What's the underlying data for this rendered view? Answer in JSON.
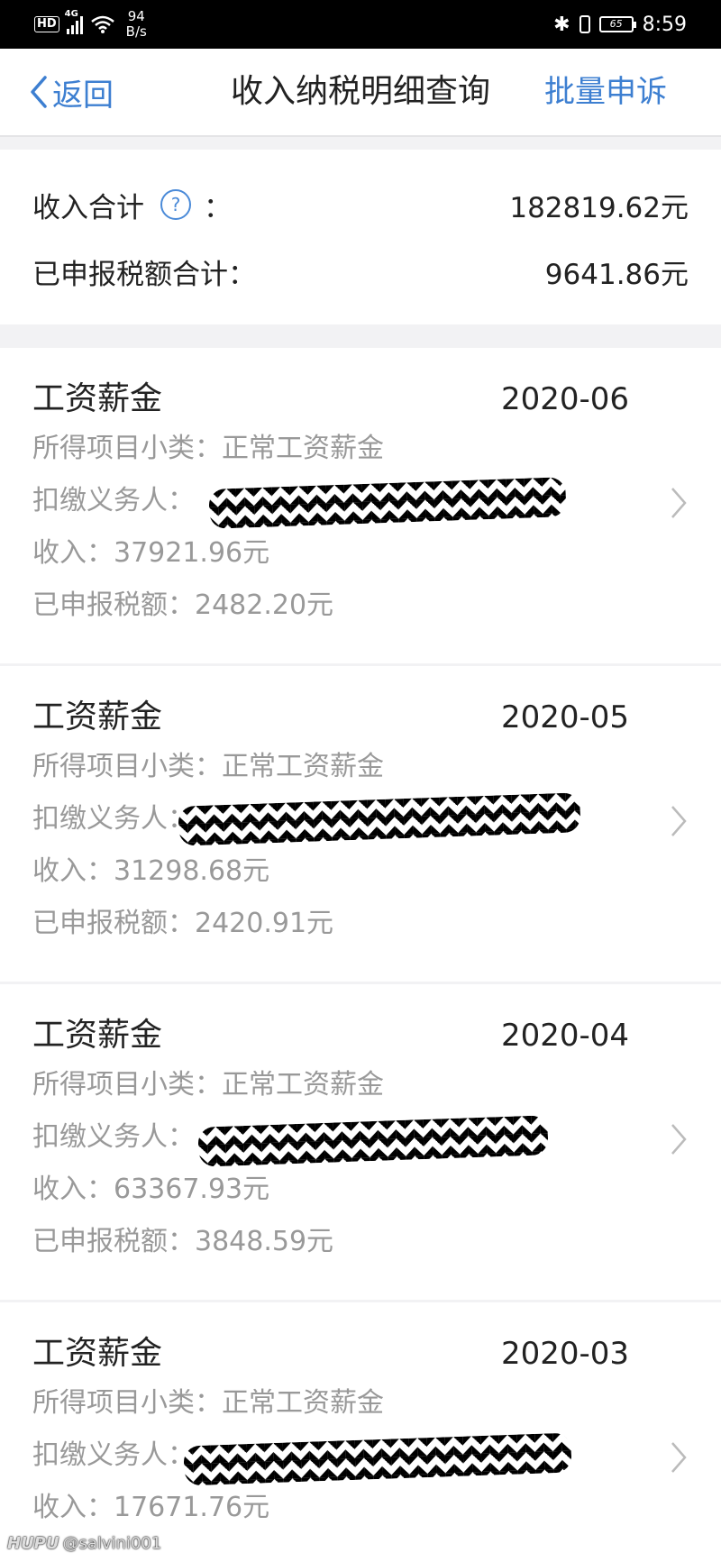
{
  "status_bar": {
    "network_badge": "HD",
    "network_type": "4G",
    "speed_value": "94",
    "speed_unit": "B/s",
    "battery": "65",
    "time": "8:59"
  },
  "nav": {
    "back_label": "返回",
    "title": "收入纳税明细查询",
    "action_label": "批量申诉"
  },
  "summary": {
    "income_label": "收入合计",
    "help_glyph": "?",
    "colon": "：",
    "income_value": "182819.62元",
    "tax_label": "已申报税额合计：",
    "tax_value": "9641.86元"
  },
  "records": [
    {
      "category": "工资薪金",
      "period": "2020-06",
      "subcategory": "所得项目小类：正常工资薪金",
      "withholder_label": "扣缴义务人：",
      "income": "收入：37921.96元",
      "tax": "已申报税额：2482.20元"
    },
    {
      "category": "工资薪金",
      "period": "2020-05",
      "subcategory": "所得项目小类：正常工资薪金",
      "withholder_label": "扣缴义务人：",
      "income": "收入：31298.68元",
      "tax": "已申报税额：2420.91元"
    },
    {
      "category": "工资薪金",
      "period": "2020-04",
      "subcategory": "所得项目小类：正常工资薪金",
      "withholder_label": "扣缴义务人：",
      "income": "收入：63367.93元",
      "tax": "已申报税额：3848.59元"
    },
    {
      "category": "工资薪金",
      "period": "2020-03",
      "subcategory": "所得项目小类：正常工资薪金",
      "withholder_label": "扣缴义务人：",
      "income": "收入：17671.76元",
      "tax": ""
    }
  ],
  "watermark": {
    "brand": "HUPU",
    "user": "@salvini001"
  },
  "colors": {
    "accent": "#3d7fd1",
    "muted_text": "#999999",
    "page_bg": "#f2f2f4"
  }
}
